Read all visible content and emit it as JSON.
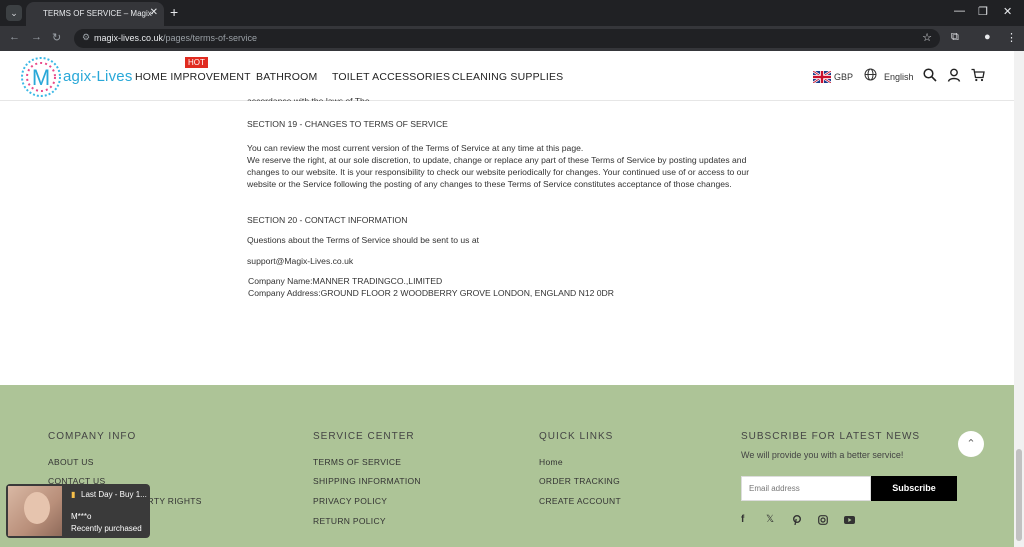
{
  "browser": {
    "tab_title": "TERMS OF SERVICE – Magix-Li",
    "url_domain": "magix-lives.co.uk",
    "url_path": "/pages/terms-of-service"
  },
  "header": {
    "brand": "agix-Lives",
    "nav": [
      "HOME IMPROVEMENT",
      "BATHROOM",
      "TOILET ACCESSORIES",
      "CLEANING SUPPLIES"
    ],
    "hot_badge": "HOT",
    "currency": "GBP",
    "language": "English"
  },
  "content": {
    "partial_line": "accordance with the laws of The",
    "section19_title": "SECTION 19 - CHANGES TO TERMS OF SERVICE",
    "section19_p1": "You can review the most current version of the Terms of Service at any time at this page.",
    "section19_p2": "We reserve the right, at our sole discretion, to update, change or replace any part of these Terms of Service by posting updates and changes to our website. It is your responsibility to check our website periodically for changes. Your continued use of or access to our website or the Service following the posting of any changes to these Terms of Service constitutes acceptance of those changes.",
    "section20_title": "SECTION 20 - CONTACT INFORMATION",
    "section20_p1": "Questions about the Terms of Service should be sent to us at",
    "email": "support@Magix-Lives.co.uk",
    "company_name": "Company Name:MANNER TRADINGCO.,LIMITED",
    "company_address": "Company Address:GROUND FLOOR 2 WOODBERRY GROVE LONDON, ENGLAND N12 0DR"
  },
  "footer": {
    "company_info": {
      "title": "COMPANY INFO",
      "links": [
        "ABOUT US",
        "CONTACT US",
        "INTELLECTUAL PROPERTY RIGHTS"
      ]
    },
    "service_center": {
      "title": "SERVICE CENTER",
      "links": [
        "TERMS OF SERVICE",
        "SHIPPING INFORMATION",
        "PRIVACY POLICY",
        "RETURN POLICY"
      ]
    },
    "quick_links": {
      "title": "QUICK LINKS",
      "links": [
        "Home",
        "ORDER TRACKING",
        "CREATE ACCOUNT"
      ]
    },
    "subscribe": {
      "title": "SUBSCRIBE FOR LATEST NEWS",
      "note": "We will provide you with a better service!",
      "placeholder": "Email address",
      "button": "Subscribe"
    }
  },
  "popup": {
    "title": "Last Day - Buy 1...",
    "buyer": "M***o",
    "status": "Recently purchased"
  },
  "colors": {
    "footer_bg": "#adc497",
    "hot_badge": "#e02b20",
    "brand": "#29a8d8"
  }
}
